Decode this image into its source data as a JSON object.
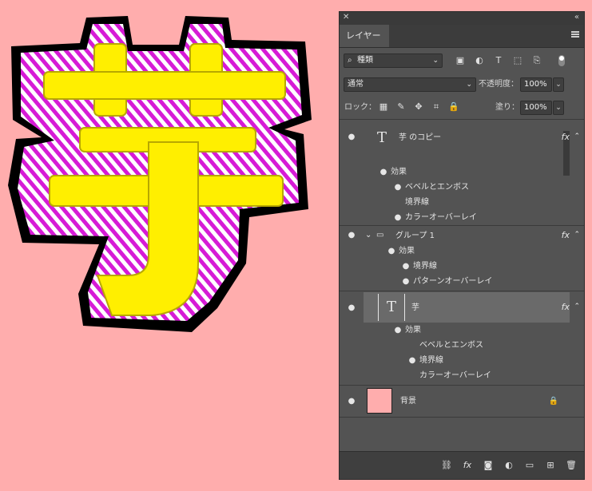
{
  "artwork": {
    "glyph": "芋",
    "colors": {
      "fill": "#ffef00",
      "stroke_pattern_a": "#d61bd6",
      "stroke_pattern_b": "#ffffff",
      "outer_stroke": "#000000",
      "canvas_bg": "#ffadad"
    }
  },
  "panel": {
    "tab_label": "レイヤー",
    "filter": {
      "label": "種類"
    },
    "blend_mode": "通常",
    "opacity_label": "不透明度：",
    "opacity_value": "100%",
    "lock_label": "ロック：",
    "fill_label": "塗り：",
    "fill_value": "100%",
    "layers": {
      "layer1": {
        "name": "芋 のコピー",
        "effects_label": "効果",
        "effects": [
          "ベベルとエンボス",
          "境界線",
          "カラーオーバーレイ"
        ]
      },
      "group1": {
        "name": "グループ 1",
        "effects_label": "効果",
        "effects": [
          "境界線",
          "パターンオーバーレイ"
        ]
      },
      "layer2": {
        "name": "芋",
        "effects_label": "効果",
        "effects": [
          "ベベルとエンボス",
          "境界線",
          "カラーオーバーレイ"
        ]
      },
      "background": {
        "name": "背景"
      }
    }
  }
}
